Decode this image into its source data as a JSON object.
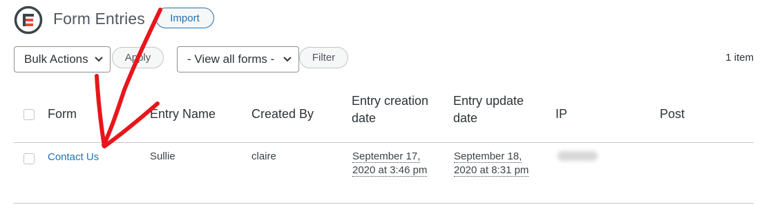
{
  "header": {
    "title": "Form Entries",
    "import_label": "Import",
    "logo_icon": "formidable-logo-icon"
  },
  "toolbar": {
    "bulk_actions": "Bulk Actions",
    "apply_label": "Apply",
    "view_forms": "- View all forms -",
    "filter_label": "Filter",
    "item_count": "1 item"
  },
  "table": {
    "headers": {
      "form": "Form",
      "entry_name": "Entry Name",
      "created_by": "Created By",
      "creation_line1": "Entry creation",
      "creation_line2": "date",
      "update_line1": "Entry update",
      "update_line2": "date",
      "ip": "IP",
      "post": "Post"
    },
    "rows": [
      {
        "form": "Contact Us",
        "entry_name": "Sullie",
        "created_by": "claire",
        "created_line1": "September 17,",
        "created_line2": "2020 at 3:46 pm",
        "updated_line1": "September 18,",
        "updated_line2": "2020 at 8:31 pm",
        "ip": "",
        "post": ""
      }
    ]
  },
  "annotation": {
    "color": "#e8161b",
    "icon": "red-arrow-annotation"
  },
  "colors": {
    "accent": "#2271b1",
    "logo_red": "#e8463c",
    "logo_dark": "#3c434a"
  }
}
